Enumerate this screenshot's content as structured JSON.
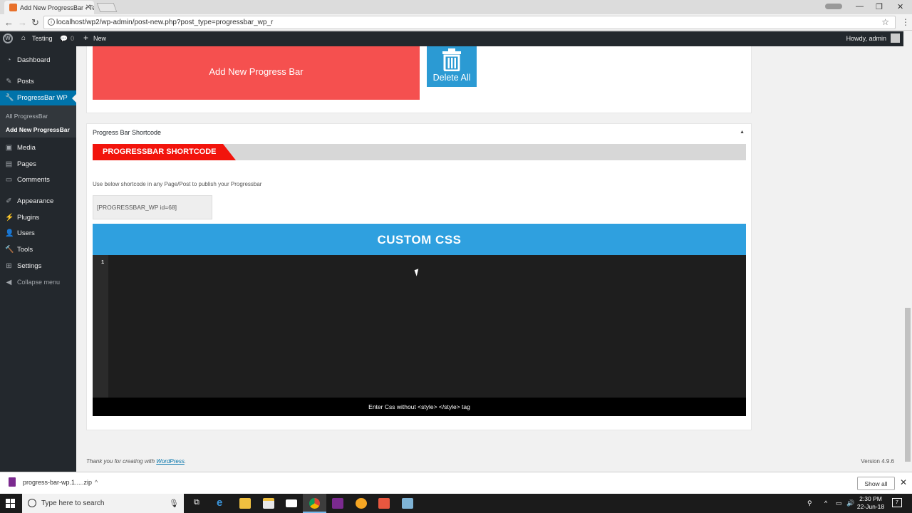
{
  "browser": {
    "tab_title": "Add New ProgressBar ‹ Te",
    "url": "localhost/wp2/wp-admin/post-new.php?post_type=progressbar_wp_r"
  },
  "adminbar": {
    "site_name": "Testing",
    "comments_count": "0",
    "new_label": "New",
    "greeting": "Howdy, admin"
  },
  "sidebar": {
    "dashboard": "Dashboard",
    "posts": "Posts",
    "progressbar": "ProgressBar WP",
    "sub_all": "All ProgressBar",
    "sub_add": "Add New ProgressBar",
    "media": "Media",
    "pages": "Pages",
    "comments": "Comments",
    "appearance": "Appearance",
    "plugins": "Plugins",
    "users": "Users",
    "tools": "Tools",
    "settings": "Settings",
    "collapse": "Collapse menu"
  },
  "main": {
    "add_button": "Add New Progress Bar",
    "delete_button": "Delete All",
    "shortcode_panel_title": "Progress Bar Shortcode",
    "ribbon": "PROGRESSBAR SHORTCODE",
    "shortcode_desc": "Use below shortcode in any Page/Post to publish your Progressbar",
    "shortcode_value": "[PROGRESSBAR_WP id=68]",
    "custom_css_title": "CUSTOM CSS",
    "editor_line": "1",
    "css_footer": "Enter Css without <style> </style> tag"
  },
  "footer": {
    "thanks_prefix": "Thank you for creating with ",
    "wordpress_link": "WordPress",
    "thanks_suffix": ".",
    "version": "Version 4.9.6"
  },
  "downloads": {
    "file": "progress-bar-wp.1.....zip",
    "show_all": "Show all"
  },
  "taskbar": {
    "search_placeholder": "Type here to search",
    "time": "2:30 PM",
    "date": "22-Jun-18",
    "notifications": "7"
  },
  "colors": {
    "add_button": "#f5504f",
    "delete_button": "#2b9ad3",
    "ribbon": "#f2140c",
    "css_header": "#2fa0df",
    "wp_admin_dark": "#23282d",
    "wp_active": "#0073aa"
  }
}
